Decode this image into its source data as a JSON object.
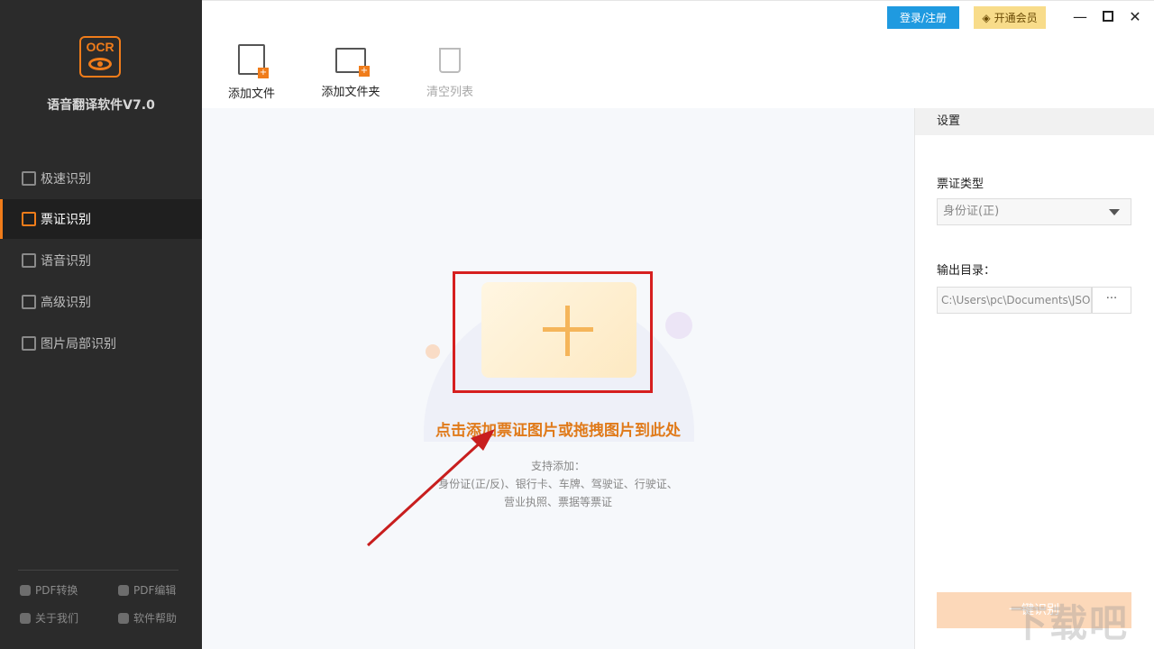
{
  "app": {
    "logo_text": "OCR",
    "title": "语音翻译软件V7.0"
  },
  "sidebar": {
    "items": [
      {
        "label": "极速识别",
        "active": false
      },
      {
        "label": "票证识别",
        "active": true
      },
      {
        "label": "语音识别",
        "active": false
      },
      {
        "label": "高级识别",
        "active": false
      },
      {
        "label": "图片局部识别",
        "active": false
      }
    ],
    "footer": [
      {
        "label": "PDF转换",
        "icon": "pdf-convert-icon"
      },
      {
        "label": "PDF编辑",
        "icon": "pdf-edit-icon"
      },
      {
        "label": "关于我们",
        "icon": "about-icon"
      },
      {
        "label": "软件帮助",
        "icon": "help-icon"
      }
    ]
  },
  "header": {
    "login_label": "登录/注册",
    "vip_label": "开通会员",
    "window_controls": [
      "minimize",
      "maximize",
      "close"
    ]
  },
  "toolbar": {
    "add_file": "添加文件",
    "add_folder": "添加文件夹",
    "clear_list": "清空列表"
  },
  "dropzone": {
    "title": "点击添加票证图片或拖拽图片到此处",
    "support_label": "支持添加：",
    "support_line1": "身份证(正/反)、银行卡、车牌、驾驶证、行驶证、",
    "support_line2": "营业执照、票据等票证"
  },
  "settings": {
    "header": "设置",
    "type_label": "票证类型",
    "type_value": "身份证(正)",
    "output_label": "输出目录：",
    "output_value": "C:\\Users\\pc\\Documents\\JSO",
    "browse_label": "···",
    "start_label": "一键识别"
  },
  "colors": {
    "accent": "#f07c1a",
    "sidebar_bg": "#2b2b2b",
    "login_blue": "#1f9ae0",
    "vip_gold": "#f8dc8a",
    "highlight_red": "#d61f1f"
  },
  "watermark": "下载吧"
}
